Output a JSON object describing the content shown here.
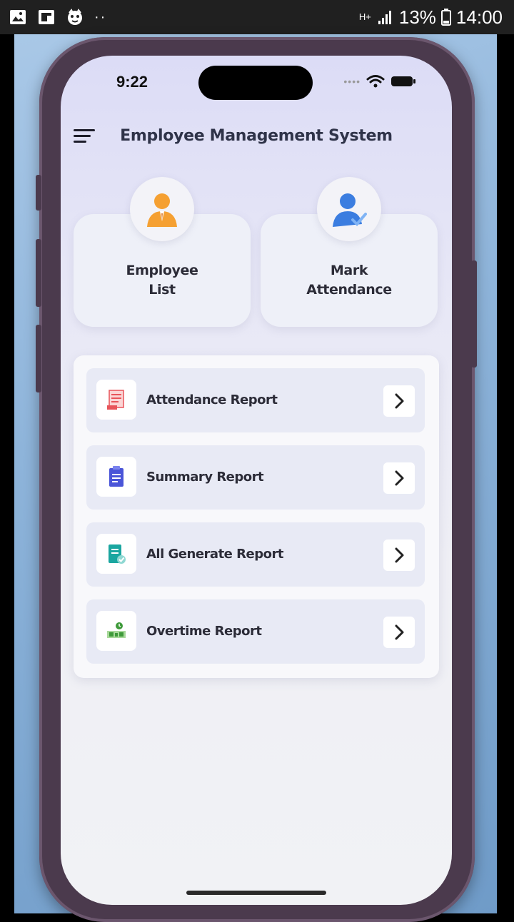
{
  "android_status": {
    "network_label": "H+",
    "battery_percent": "13%",
    "time": "14:00",
    "dots": "··"
  },
  "ios_status": {
    "time": "9:22"
  },
  "app": {
    "title": "Employee Management System"
  },
  "tiles": [
    {
      "label_line1": "Employee",
      "label_line2": "List",
      "icon": "employee-icon",
      "color": "#f5a032"
    },
    {
      "label_line1": "Mark",
      "label_line2": "Attendance",
      "icon": "attendance-user-icon",
      "color": "#3b7de0"
    }
  ],
  "reports": [
    {
      "label": "Attendance Report",
      "icon": "attendance-report-icon",
      "color": "#e8545a"
    },
    {
      "label": "Summary Report",
      "icon": "summary-report-icon",
      "color": "#4a55d8"
    },
    {
      "label": "All Generate Report",
      "icon": "generate-report-icon",
      "color": "#1aa6a0"
    },
    {
      "label": "Overtime Report",
      "icon": "overtime-report-icon",
      "color": "#3e9a3a"
    }
  ]
}
